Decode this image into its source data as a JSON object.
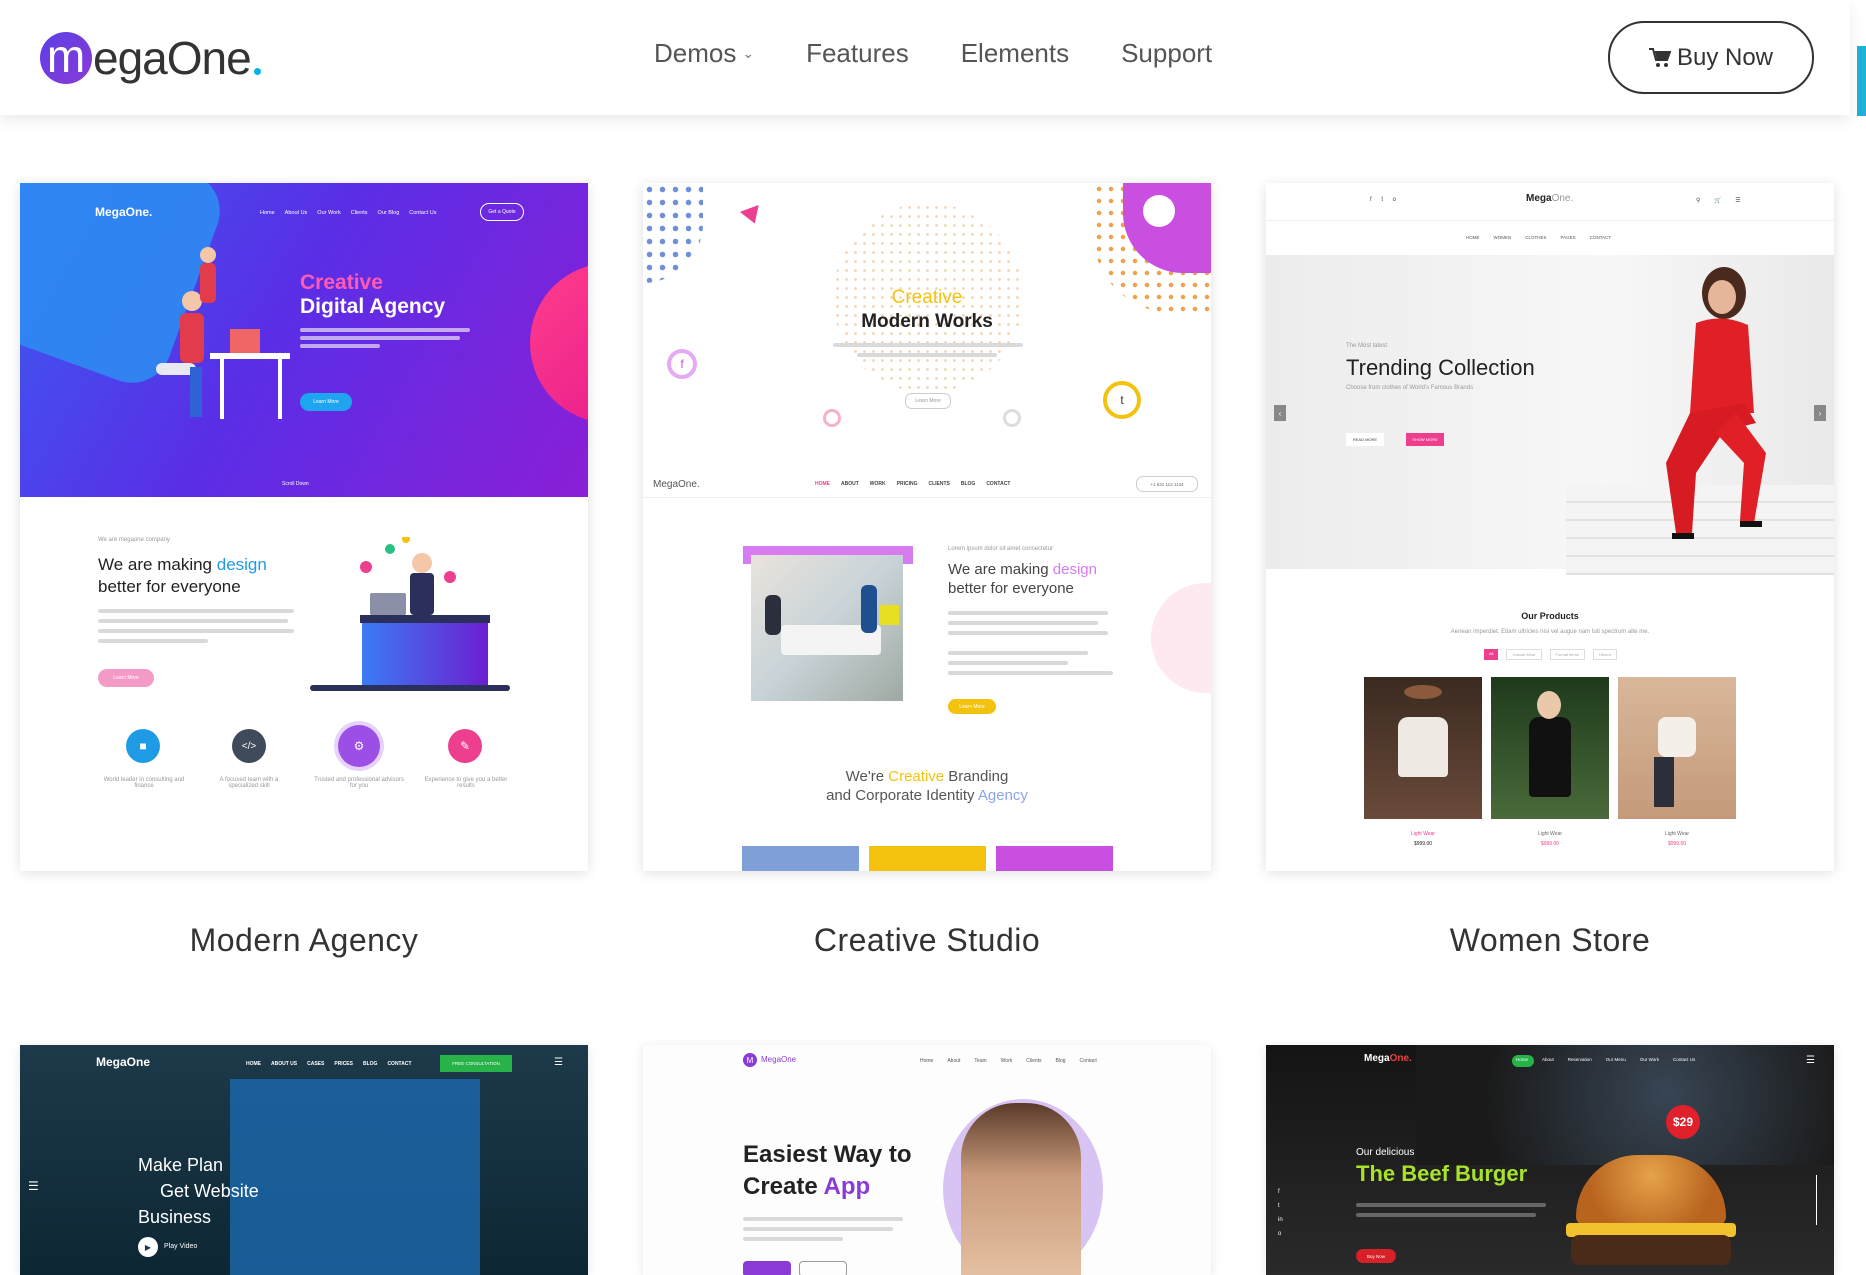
{
  "brand": {
    "logo_letter": "m",
    "logo_rest": "egaOne",
    "accent": "#5b3fe6",
    "dot_color": "#00b4e6"
  },
  "nav": {
    "items": [
      {
        "label": "Demos",
        "has_dropdown": true
      },
      {
        "label": "Features"
      },
      {
        "label": "Elements"
      },
      {
        "label": "Support"
      }
    ],
    "buy_label": "Buy Now",
    "buy_icon": "cart-icon"
  },
  "cards": [
    {
      "title": "Modern Agency",
      "preview": {
        "brand": "MegaOne.",
        "menu": [
          "Home",
          "About Us",
          "Our Work",
          "Clients",
          "Our Blog",
          "Contact Us"
        ],
        "cta": "Get a Quote",
        "hero_accent": "Creative",
        "hero_title": "Digital Agency",
        "hero_button": "Learn More",
        "scroll_label": "Scroll Down",
        "tagline_small": "We are megaone company",
        "tagline_a": "We are making ",
        "tagline_accent": "design",
        "tagline_b": "better for everyone",
        "lower_button": "Learn More",
        "features": [
          {
            "text": "World leader in consulting and finance",
            "color": "#1f9be6",
            "icon": "folder-icon"
          },
          {
            "text": "A focused team with a specialized skill",
            "color": "#3f4a5a",
            "icon": "code-icon"
          },
          {
            "text": "Trusted and professional advisors for you",
            "color": "#9b4fe6",
            "icon": "gear-icon"
          },
          {
            "text": "Experience to give you a better results",
            "color": "#ee3f8f",
            "icon": "edit-icon"
          }
        ]
      }
    },
    {
      "title": "Creative Studio",
      "preview": {
        "hero_accent": "Creative",
        "hero_title": "Modern Works",
        "hero_button": "Learn More",
        "brand": "MegaOne.",
        "menu": [
          "HOME",
          "ABOUT",
          "WORK",
          "PRICING",
          "CLIENTS",
          "BLOG",
          "CONTACT"
        ],
        "phone": "+1 631 112 1134",
        "about_small": "Lorem ipsum dolor sit amet consectetur",
        "about_a": "We are making ",
        "about_accent": "design",
        "about_b": "better for everyone",
        "about_button": "Learn More",
        "brand_line_a": "We're ",
        "brand_line_accent": "Creative",
        "brand_line_b": " Branding",
        "brand_line2_a": "and Corporate Identity ",
        "brand_line2_accent": "Agency",
        "tiles": [
          "#7f9fd8",
          "#f3c20e",
          "#c94fe0"
        ]
      }
    },
    {
      "title": "Women Store",
      "preview": {
        "brand_a": "Mega",
        "brand_b": "One.",
        "menu": [
          "HOME",
          "WOMEN",
          "CLOTHES",
          "PAGES",
          "CONTACT"
        ],
        "hero_small": "The Most latest",
        "hero_title": "Trending Collection",
        "hero_sub": "Choose from clothes of World's Famous Brands",
        "btn_a": "READ MORE",
        "btn_b": "SHOW MORE",
        "products_title": "Our Products",
        "products_sub": "Aenean imperdiet. Etiam ultricies nisi vel augue nam tuti spectrum alte me.",
        "filters": [
          "All",
          "Casual Wear",
          "Formal Items",
          "Others"
        ],
        "products": [
          {
            "name": "Light Wear",
            "price": "$999.00"
          },
          {
            "name": "Light Wear",
            "price": "$999.00"
          },
          {
            "name": "Light Wear",
            "price": "$999.00"
          }
        ]
      }
    },
    {
      "preview": {
        "brand": "MegaOne",
        "menu": [
          "HOME",
          "ABOUT US",
          "CASES",
          "PRICES",
          "BLOG",
          "CONTACT"
        ],
        "cta": "FREE CONSULTATION",
        "line1": "Make Plan",
        "line2": "Get Website",
        "line3": "Business",
        "play": "Play Video"
      }
    },
    {
      "preview": {
        "brand": "MegaOne",
        "menu": [
          "Home",
          "About",
          "Team",
          "Work",
          "Clients",
          "Blog",
          "Contact"
        ],
        "headline_a": "Easiest Way to",
        "headline_b": "Create ",
        "headline_accent": "App"
      }
    },
    {
      "preview": {
        "brand_a": "Mega",
        "brand_b": "One.",
        "menu": [
          "Home",
          "About",
          "Reservation",
          "Our Menu",
          "Our Work",
          "Contact Us"
        ],
        "small": "Our delicious",
        "title": "The Beef Burger",
        "button": "Buy Now",
        "price": "$29"
      }
    }
  ]
}
